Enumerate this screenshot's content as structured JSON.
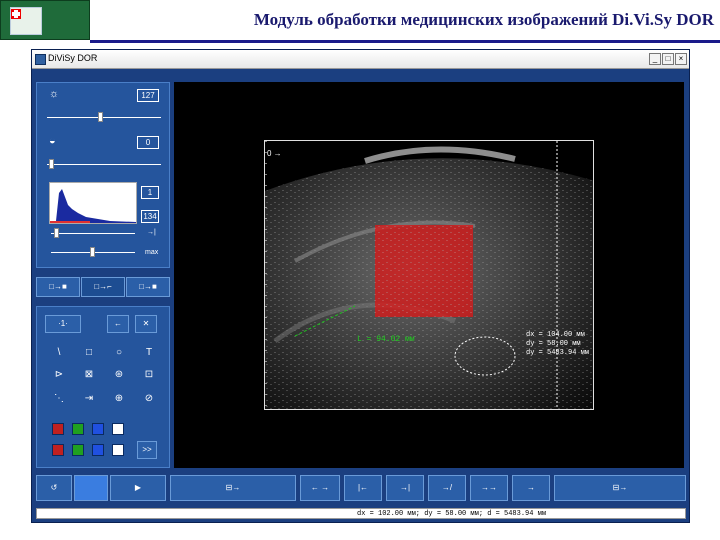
{
  "slide": {
    "title": "Модуль обработки медицинских изображений Di.Vi.Sy DOR"
  },
  "window": {
    "title": "DiViSy DOR",
    "buttons": [
      "_",
      "□",
      "×"
    ]
  },
  "side_panel": {
    "brightness": {
      "icon": "brightness-icon",
      "value": "127"
    },
    "contrast": {
      "icon": "contrast-icon",
      "value": "0"
    },
    "histogram": {
      "min_value": "1",
      "max_value": "134",
      "max_label": "max"
    },
    "row1_buttons": [
      "□→■",
      "□→⌐",
      "□→■"
    ],
    "nav_buttons": [
      "·1·",
      "←",
      "✕"
    ],
    "tools": [
      "\\",
      "□",
      "○",
      "T",
      "⊳",
      "⊠",
      "⊛",
      "⊡",
      "⋱",
      "⇥",
      "⊕",
      "⊘"
    ],
    "swatch_colors": [
      "#c02020",
      "#20a020",
      "#2050e0",
      "#ffffff",
      "#c02020",
      "#20a020",
      "#2050e0",
      "#ffffff"
    ],
    "more_label": ">>"
  },
  "viewport": {
    "depth_marker": "0 →",
    "length_label": "L = 94.02 мм",
    "measure": {
      "dx": "dx = 104.00 мм",
      "dy": "dy = 58.00 мм",
      "dz": "dy = 5483.94 мм"
    },
    "overlay_color": "#d81818"
  },
  "bottom_bar": {
    "left_buttons": [
      "↺",
      "",
      "▶"
    ],
    "mid_buttons": [
      "⊟→",
      "←  →",
      "|←",
      "→|",
      "→/",
      "→→",
      "→",
      "⊟→"
    ]
  },
  "status_bar": {
    "text": "dx = 102.00 мм; dy = 58.00 мм; d = 5483.94 мм"
  }
}
